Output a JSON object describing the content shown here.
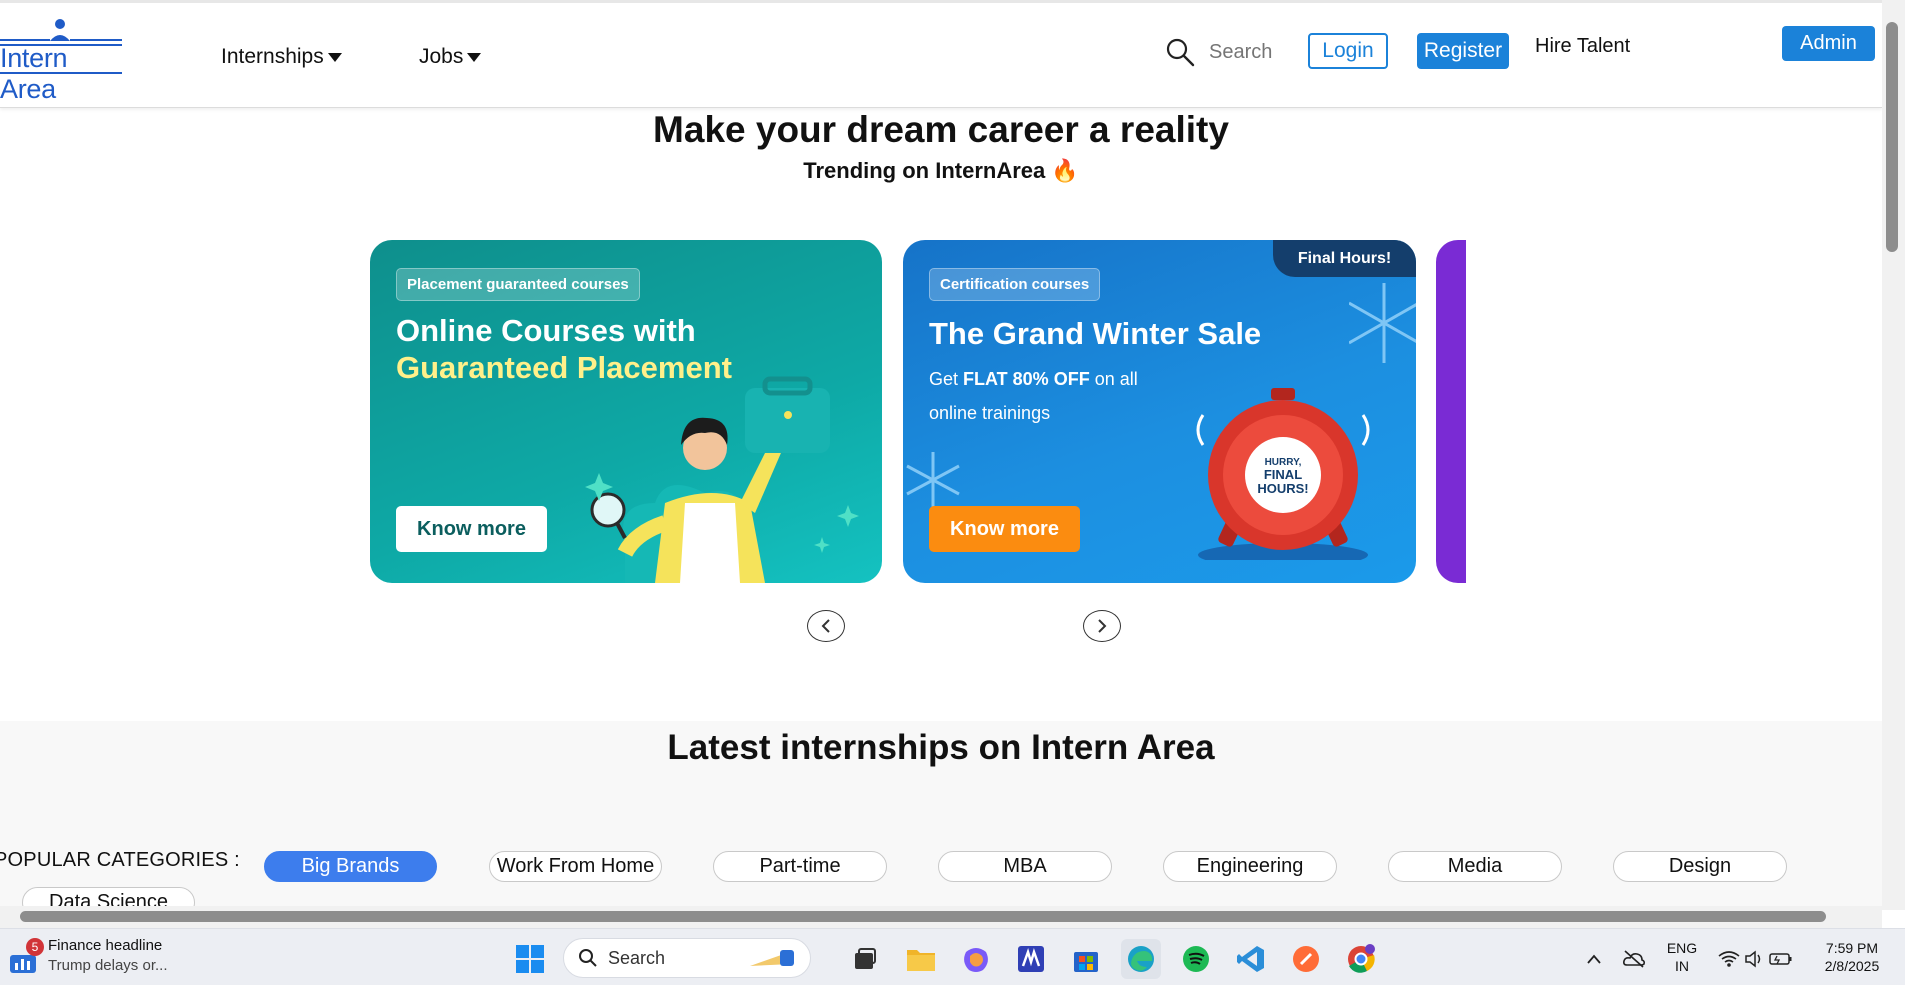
{
  "navbar": {
    "logo_text": "Intern Area",
    "internships": "Internships",
    "jobs": "Jobs",
    "search_placeholder": "Search",
    "login": "Login",
    "register": "Register",
    "hire": "Hire Talent",
    "admin": "Admin"
  },
  "hero": {
    "title": "Make your dream career a reality",
    "subtitle": "Trending on InternArea 🔥"
  },
  "cards": [
    {
      "chip": "Placement guaranteed courses",
      "line1": "Online Courses with",
      "line2": "Guaranteed Placement",
      "button": "Know more"
    },
    {
      "chip": "Certification courses",
      "badge": "Final Hours!",
      "title": "The Grand Winter Sale",
      "body_prefix": "Get ",
      "body_bold": "FLAT 80% OFF",
      "body_suffix": " on all online trainings",
      "clock_text": "HURRY, FINAL HOURS!",
      "button": "Know more"
    }
  ],
  "latest": {
    "title": "Latest internships on Intern Area",
    "categories_label": "POPULAR CATEGORIES :",
    "categories": [
      "Big Brands",
      "Work From Home",
      "Part-time",
      "MBA",
      "Engineering",
      "Media",
      "Design",
      "Data Science"
    ],
    "active_category": "Big Brands"
  },
  "taskbar": {
    "news_badge": "5",
    "news_headline": "Finance headline",
    "news_sub": "Trump delays or...",
    "search": "Search",
    "lang1": "ENG",
    "lang2": "IN",
    "time": "7:59 PM",
    "date": "2/8/2025"
  },
  "colors": {
    "brand_blue": "#1b82d9",
    "active_pill": "#3d7ded",
    "card1": "#0ea9a6",
    "card2": "#1c8fe0",
    "orange": "#fb8c10"
  }
}
